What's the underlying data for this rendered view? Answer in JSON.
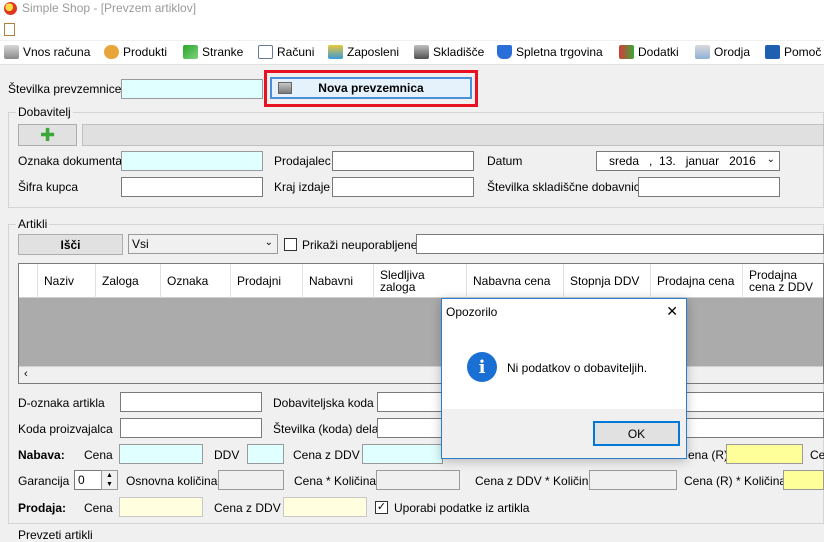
{
  "window": {
    "title": "Simple Shop - [Prevzem artiklov]"
  },
  "menu": {
    "items": [
      {
        "label": "Vnos računa",
        "icon": "printer-icon"
      },
      {
        "label": "Produkti",
        "icon": "bread-icon"
      },
      {
        "label": "Stranke",
        "icon": "flag-icon"
      },
      {
        "label": "Računi",
        "icon": "document-icon"
      },
      {
        "label": "Zaposleni",
        "icon": "money-icon"
      },
      {
        "label": "Skladišče",
        "icon": "warehouse-icon"
      },
      {
        "label": "Spletna trgovina",
        "icon": "cart-icon"
      },
      {
        "label": "Dodatki",
        "icon": "addons-icon"
      },
      {
        "label": "Orodja",
        "icon": "tools-icon"
      },
      {
        "label": "Pomoč",
        "icon": "help-icon"
      }
    ]
  },
  "top": {
    "stevilka_label": "Številka prevzemnice",
    "stevilka_value": "",
    "nova_button": "Nova prevzemnica"
  },
  "dobavitelj": {
    "group_title": "Dobavitelj",
    "oznaka_label": "Oznaka dokumenta",
    "sifra_label": "Šifra kupca",
    "prodajalec_label": "Prodajalec",
    "kraj_label": "Kraj izdaje",
    "datum_label": "Datum",
    "datum_value": "sreda   ,  13.   januar   2016",
    "skladiscna_label": "Številka skladiščne dobavnice"
  },
  "artikli": {
    "group_title": "Artikli",
    "isci_button": "Išči",
    "filter_value": "Vsi",
    "neuporabljene_label": "Prikaži neuporabljene",
    "columns": [
      "Naziv",
      "Zaloga",
      "Oznaka",
      "Prodajni",
      "Nabavni",
      "Sledljiva zaloga",
      "Nabavna cena",
      "Stopnja DDV",
      "Prodajna cena",
      "Prodajna cena z DDV"
    ]
  },
  "details": {
    "d_oznaka_label": "D-oznaka artikla",
    "dobaviteljska_label": "Dobaviteljska koda",
    "koda_proizvajalca_label": "Koda proizvajalca",
    "stevilka_dela_label": "Številka (koda) dela",
    "nabava_label": "Nabava:",
    "cena_label": "Cena",
    "ddv_label": "DDV",
    "cena_z_ddv_label": "Cena z DDV",
    "cena_r_label": "ena (R)",
    "ce_label": "Ce",
    "garancija_label": "Garancija",
    "garancija_value": "0",
    "osnovna_kolicina_label": "Osnovna količina",
    "cena_kolicina_label": "Cena * Količina",
    "cena_z_ddv_kolicina_label": "Cena z DDV * Količina",
    "cena_r_kolicina_label": "Cena (R) * Količina",
    "prodaja_label": "Prodaja:",
    "prodaja_cena_label": "Cena",
    "prodaja_cena_z_ddv_label": "Cena z DDV",
    "uporabi_label": "Uporabi podatke iz artikla",
    "prevzeti_title": "Prevzeti artikli"
  },
  "dialog": {
    "title": "Opozorilo",
    "message": "Ni podatkov o dobaviteljih.",
    "ok": "OK",
    "close_glyph": "✕",
    "info_glyph": "i"
  },
  "colors": {
    "cyan_field": "#e0ffff",
    "yellow_field": "#ffff99",
    "highlight_border": "#e81123",
    "dialog_border": "#2a7ccc",
    "info_blue": "#1a6fd4"
  }
}
